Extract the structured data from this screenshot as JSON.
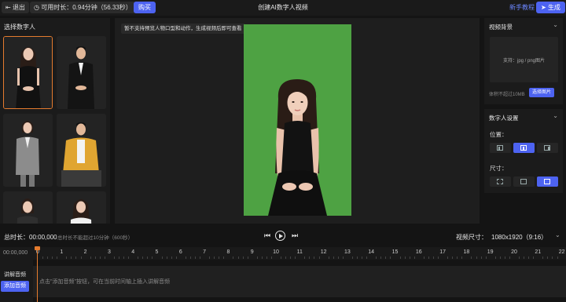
{
  "topbar": {
    "exit_label": "退出",
    "time_label": "可用时长：0.94分钟（56.33秒）",
    "buy_label": "购买",
    "title": "创建AI数字人视频",
    "tutorial_label": "新手教程",
    "generate_label": "生成"
  },
  "left_panel": {
    "title": "选择数字人"
  },
  "preview": {
    "tip": "暂不支持预览人物口型和动作，生成视频后即可查看",
    "background_color": "#4ea243"
  },
  "bg_panel": {
    "title": "视频背景",
    "upload_hint": "支持：jpg / png图片",
    "size_limit": "体积不超过10MB",
    "choose_label": "选择图片"
  },
  "avatar_settings": {
    "title": "数字人设置",
    "position_label": "位置：",
    "size_label": "尺寸："
  },
  "player": {
    "duration_label": "总时长：00:00,000",
    "duration_note": "总时长不能超过10分钟（600秒）",
    "video_size_label": "视频尺寸：",
    "video_size_value": "1080x1920（9:16）"
  },
  "timeline": {
    "start_time": "00:00,000",
    "ticks": [
      "0",
      "1",
      "2",
      "3",
      "4",
      "5",
      "6",
      "7",
      "8",
      "9",
      "10",
      "11",
      "12",
      "13",
      "14",
      "15",
      "16",
      "17",
      "18",
      "19",
      "20",
      "21",
      "22"
    ],
    "track_title": "讲解音频",
    "add_audio_label": "添加音频",
    "lane_hint": "点击\"添加音频\"按钮，可在当前时间轴上插入讲解音频"
  },
  "colors": {
    "accent": "#4d63f1",
    "selected_border": "#e57b2e",
    "playhead": "#e57b2e",
    "green_screen": "#4ea243"
  }
}
